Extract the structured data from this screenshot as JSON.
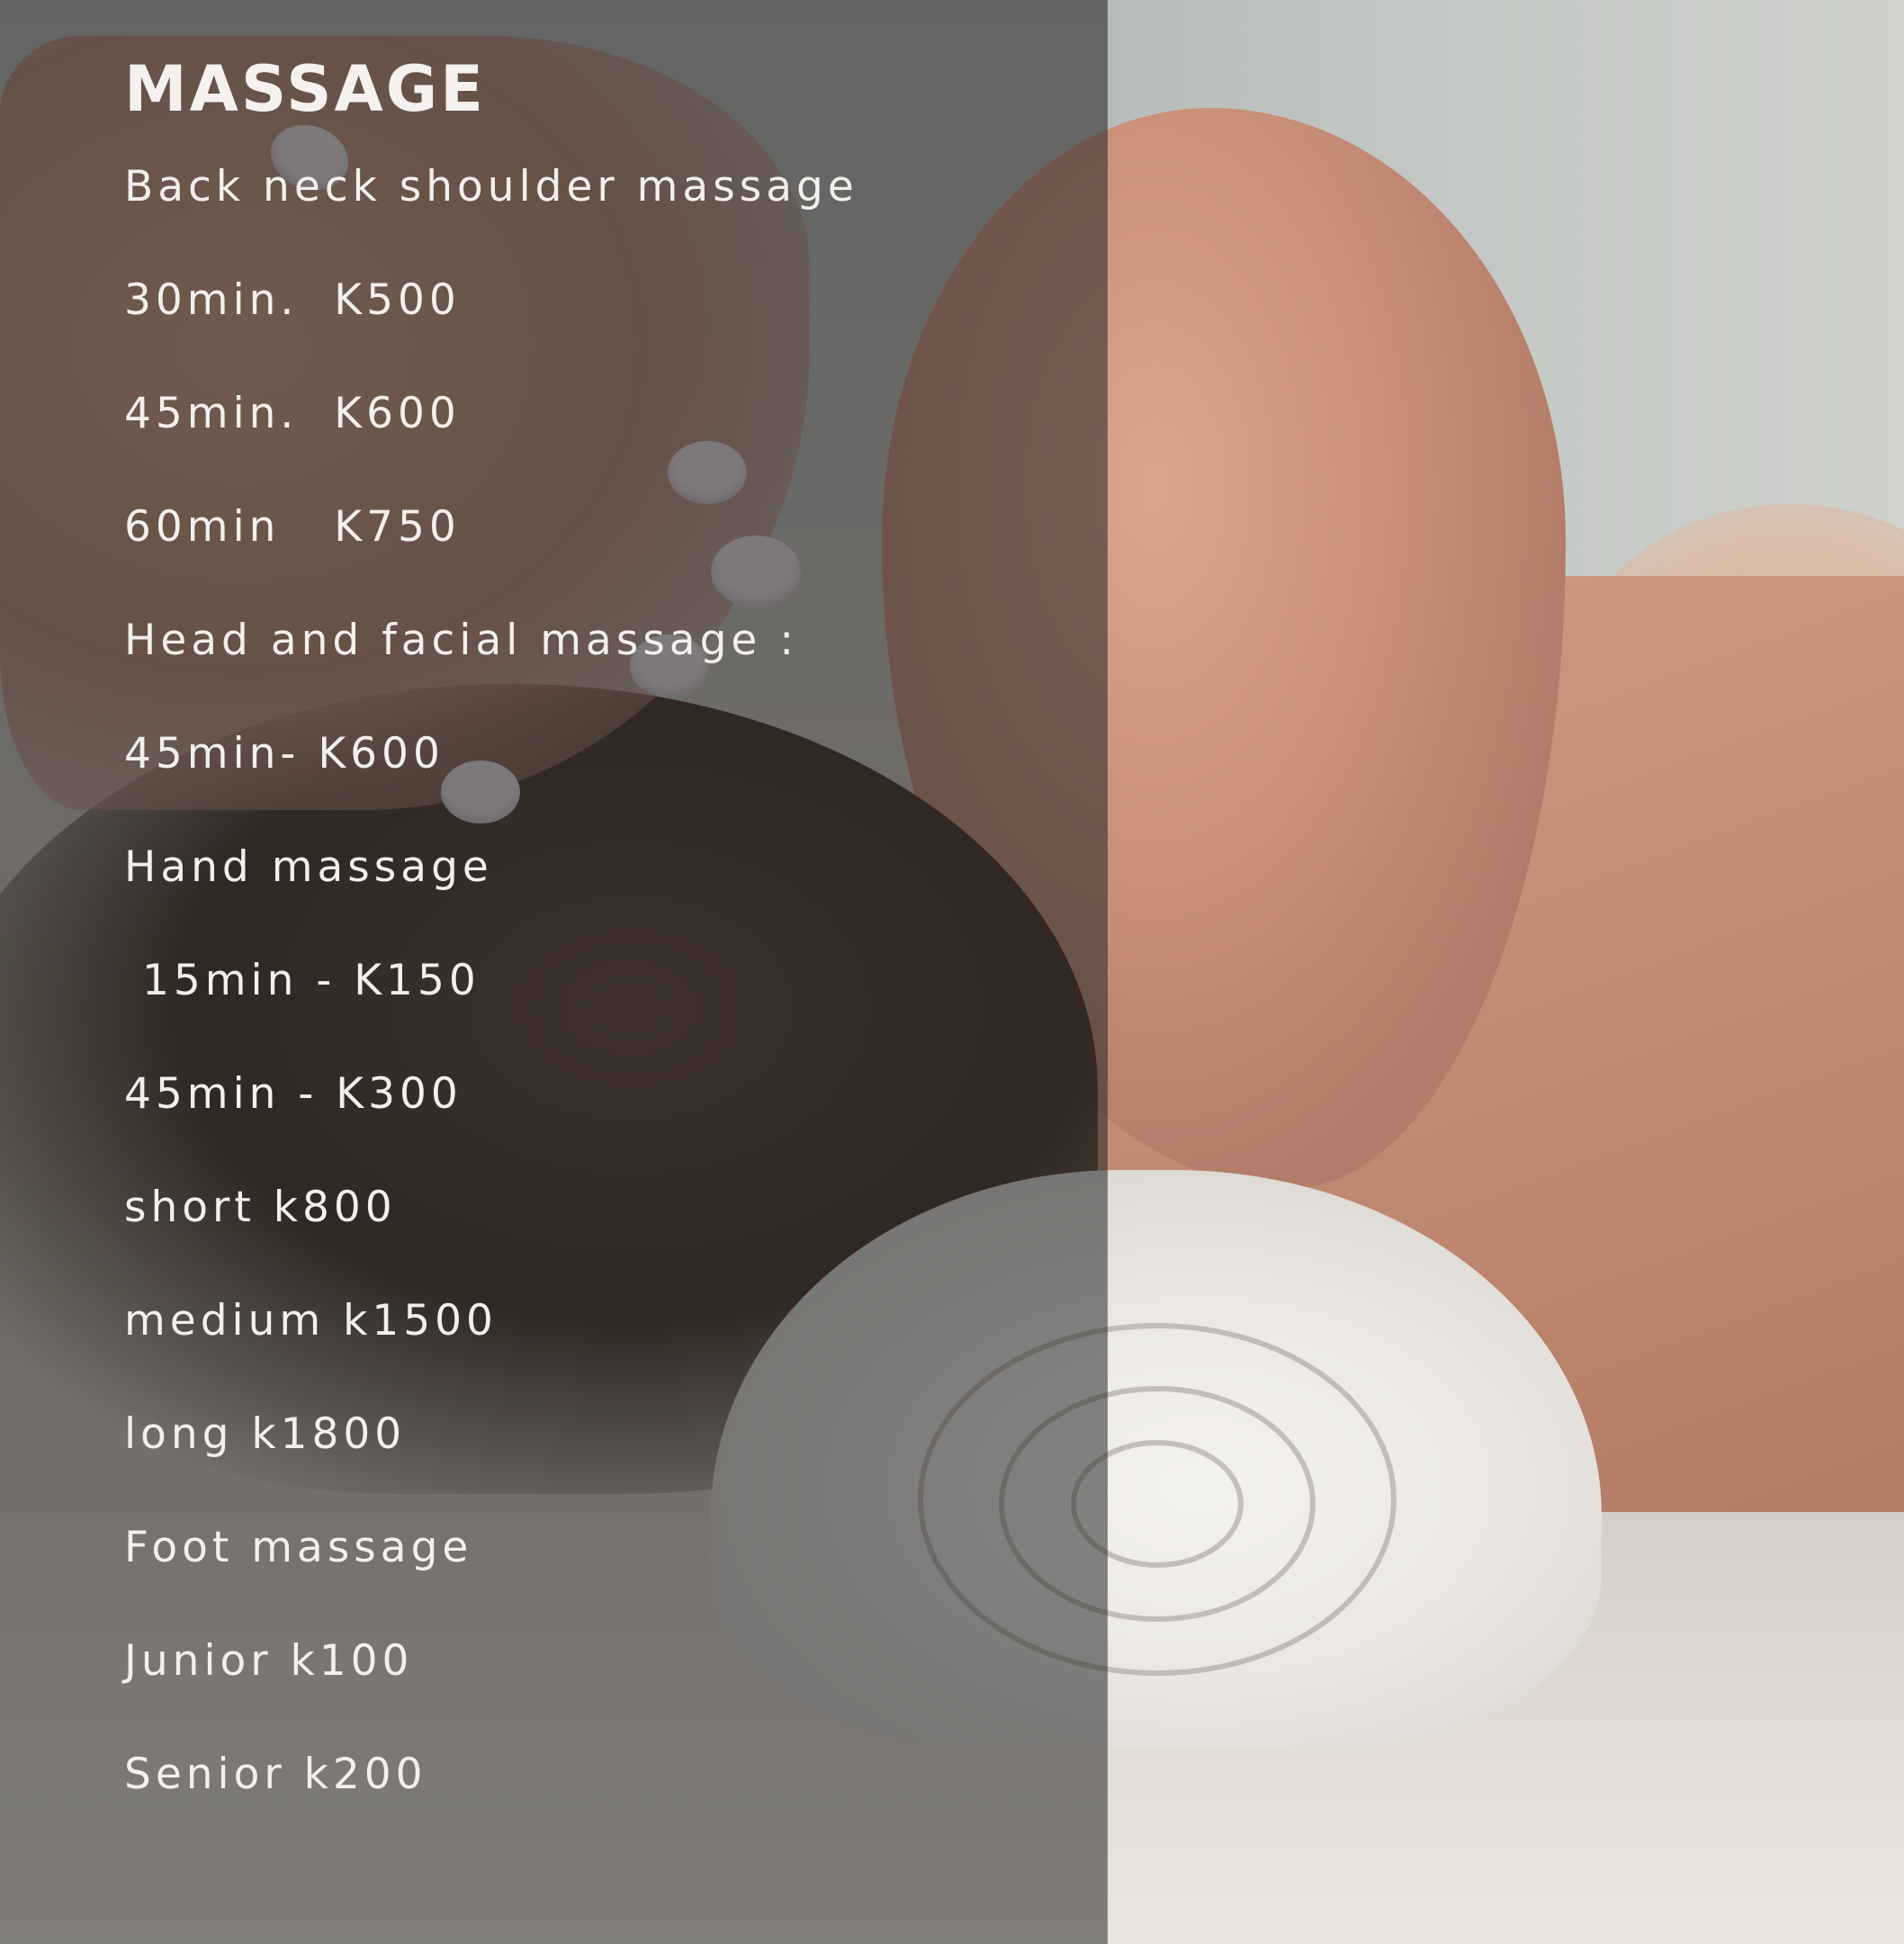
{
  "menu": {
    "title": "MASSAGE",
    "lines": [
      "Back neck shoulder massage",
      "30min.  K500",
      "45min.  K600",
      "60min   K750",
      "Head and facial massage :",
      "45min- K600",
      "Hand massage",
      " 15min - K150",
      "45min - K300",
      "short k800",
      "medium k1500",
      "long k1800",
      "Foot massage",
      "Junior k100",
      "Senior k200"
    ]
  },
  "colors": {
    "overlay": "#262626",
    "text": "#f3efec"
  }
}
